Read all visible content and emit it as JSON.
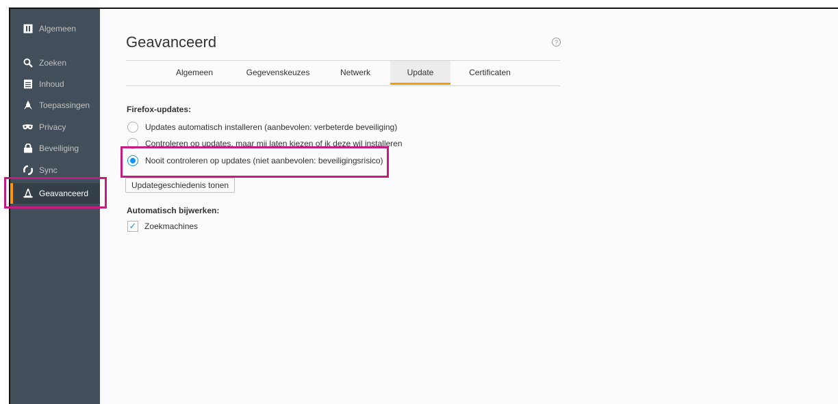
{
  "sidebar": {
    "items": [
      {
        "label": "Algemeen",
        "icon": "general-icon",
        "active": false
      },
      {
        "label": "Zoeken",
        "icon": "search-icon",
        "active": false
      },
      {
        "label": "Inhoud",
        "icon": "document-icon",
        "active": false
      },
      {
        "label": "Toepassingen",
        "icon": "rocket-icon",
        "active": false
      },
      {
        "label": "Privacy",
        "icon": "mask-icon",
        "active": false
      },
      {
        "label": "Beveiliging",
        "icon": "lock-icon",
        "active": false
      },
      {
        "label": "Sync",
        "icon": "sync-icon",
        "active": false
      },
      {
        "label": "Geavanceerd",
        "icon": "wizard-hat-icon",
        "active": true
      }
    ]
  },
  "main": {
    "title": "Geavanceerd",
    "help_symbol": "?",
    "tabs": [
      {
        "label": "Algemeen",
        "active": false
      },
      {
        "label": "Gegevenskeuzes",
        "active": false
      },
      {
        "label": "Netwerk",
        "active": false
      },
      {
        "label": "Update",
        "active": true
      },
      {
        "label": "Certificaten",
        "active": false
      }
    ],
    "updates_section": {
      "heading": "Firefox-updates:",
      "options": [
        {
          "label": "Updates automatisch installeren (aanbevolen: verbeterde beveiliging)",
          "checked": false
        },
        {
          "label": "Controleren op updates, maar mij laten kiezen of ik deze wil installeren",
          "checked": false
        },
        {
          "label": "Nooit controleren op updates (niet aanbevolen: beveiligingsrisico)",
          "checked": true
        }
      ],
      "history_button": "Updategeschiedenis tonen"
    },
    "auto_update_section": {
      "heading": "Automatisch bijwerken:",
      "checkbox_label": "Zoekmachines",
      "checked": true,
      "check_symbol": "✓"
    }
  },
  "colors": {
    "sidebar_bg": "#424f5a",
    "accent": "#ff9500",
    "radio_selected": "#0996f8",
    "highlight": "#c81b82"
  }
}
